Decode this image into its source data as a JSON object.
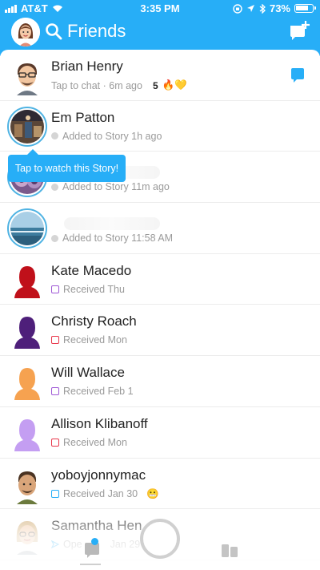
{
  "status_bar": {
    "carrier": "AT&T",
    "time": "3:35 PM",
    "battery": "73%"
  },
  "header": {
    "title": "Friends",
    "search_icon": "search-icon",
    "new_chat_icon": "new-chat-icon",
    "accent": "#27aef7"
  },
  "tooltip": {
    "text": "Tap to watch this Story!"
  },
  "friends": [
    {
      "name": "Brian Henry",
      "status": "Tap to chat · 6m ago",
      "streak": "5",
      "streak_emoji": "🔥💛"
    },
    {
      "name": "Em Patton",
      "status": "Added to Story 1h ago"
    },
    {
      "name": "",
      "status": "Added to Story 11m ago"
    },
    {
      "name": "",
      "status": "Added to Story 11:58 AM"
    },
    {
      "name": "Kate Macedo",
      "status": "Received Thu",
      "color": "#c0101a"
    },
    {
      "name": "Christy Roach",
      "status": "Received Mon",
      "color": "#4e1f7a"
    },
    {
      "name": "Will Wallace",
      "status": "Received Feb 1",
      "color": "#f6a250"
    },
    {
      "name": "Allison Klibanoff",
      "status": "Received Mon",
      "color": "#c49ef2"
    },
    {
      "name": "yoboyjonnymac",
      "status": "Received Jan 30",
      "emoji": "😬"
    },
    {
      "name": "Samantha Hen",
      "status": "Ope",
      "status_tail": "Jan 29"
    }
  ],
  "status_colors": {
    "story": "#d5d5d5",
    "red": "#e8374b",
    "purple": "#a05ad6",
    "blue": "#27aef7"
  }
}
